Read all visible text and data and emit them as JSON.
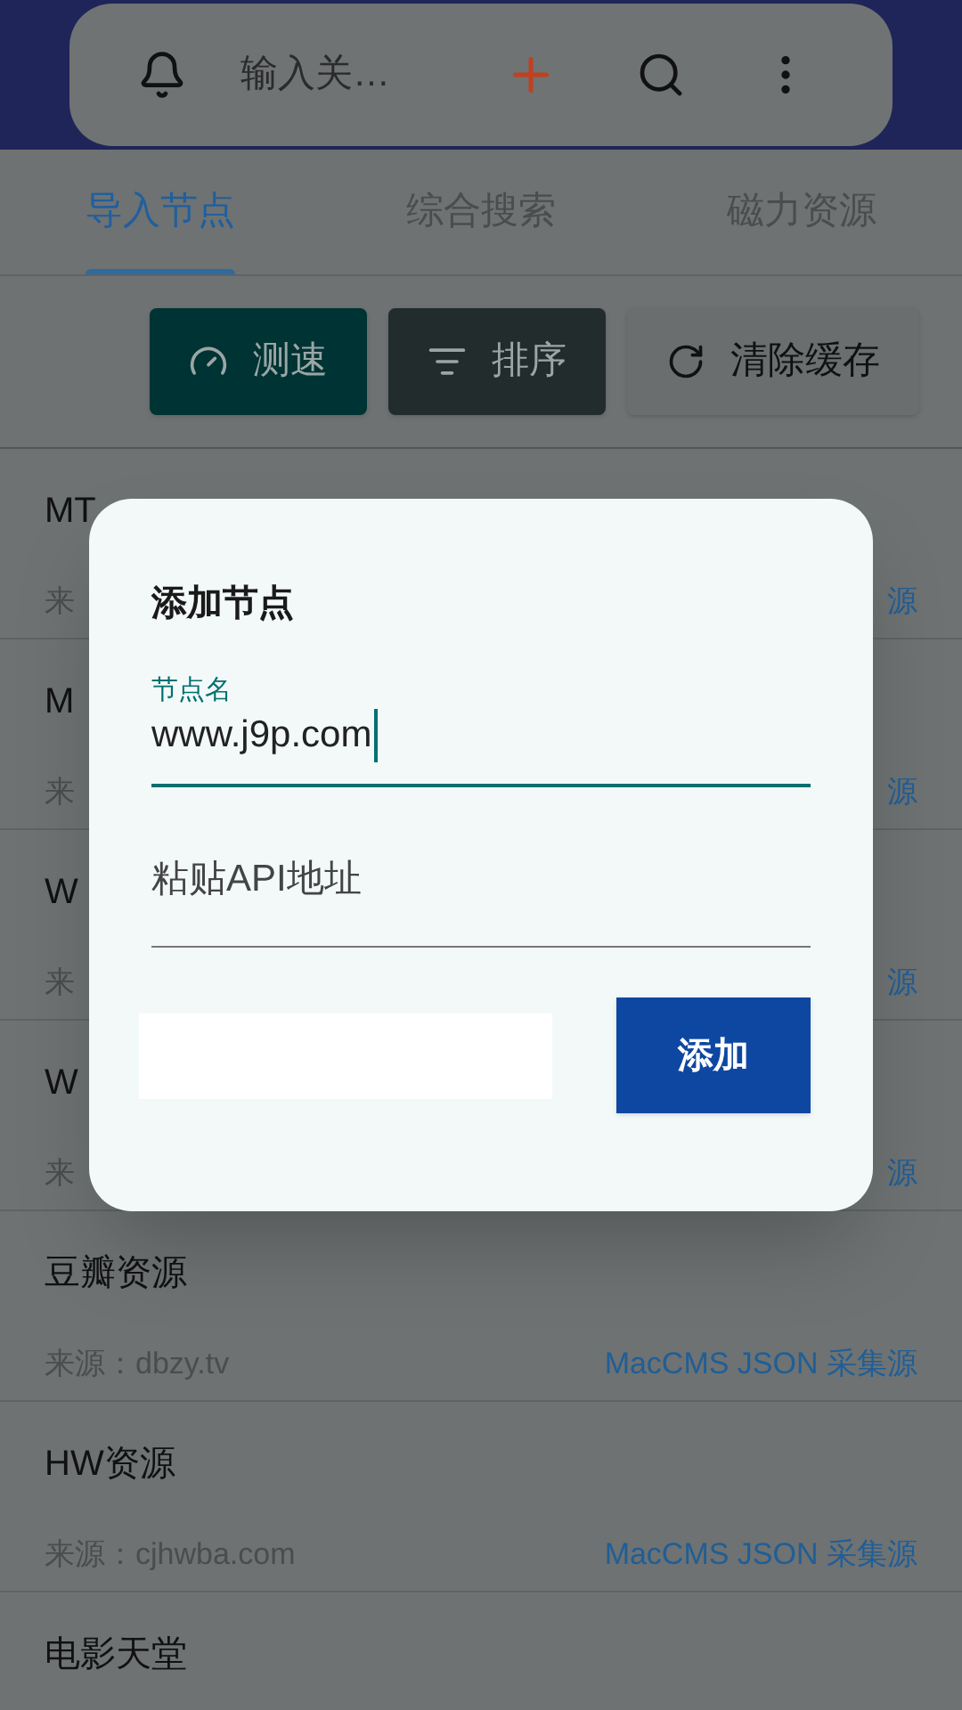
{
  "search_bar": {
    "placeholder": "输入关…"
  },
  "tabs": [
    {
      "label": "导入节点",
      "selected": true
    },
    {
      "label": "综合搜索",
      "selected": false
    },
    {
      "label": "磁力资源",
      "selected": false
    }
  ],
  "toolbar": [
    {
      "kind": "speed",
      "label": "测速"
    },
    {
      "kind": "sort",
      "label": "排序"
    },
    {
      "kind": "refresh",
      "label": "清除缓存"
    }
  ],
  "nodes": [
    {
      "name": "MT",
      "source": "来",
      "type": "源"
    },
    {
      "name": "M",
      "source": "来",
      "type": "源"
    },
    {
      "name": "W",
      "source": "来",
      "type": "源"
    },
    {
      "name": "W",
      "source": "来",
      "type": "源"
    },
    {
      "name": "豆瓣资源",
      "source": "来源：dbzy.tv",
      "type": "MacCMS JSON 采集源"
    },
    {
      "name": "HW资源",
      "source": "来源：cjhwba.com",
      "type": "MacCMS JSON 采集源"
    },
    {
      "name": "电影天堂"
    }
  ],
  "dialog": {
    "title": "添加节点",
    "fields": [
      {
        "label": "节点名",
        "value": "www.j9p.com",
        "focused": true
      },
      {
        "placeholder": "粘贴API地址",
        "focused": false
      }
    ],
    "add_button": "添加"
  }
}
